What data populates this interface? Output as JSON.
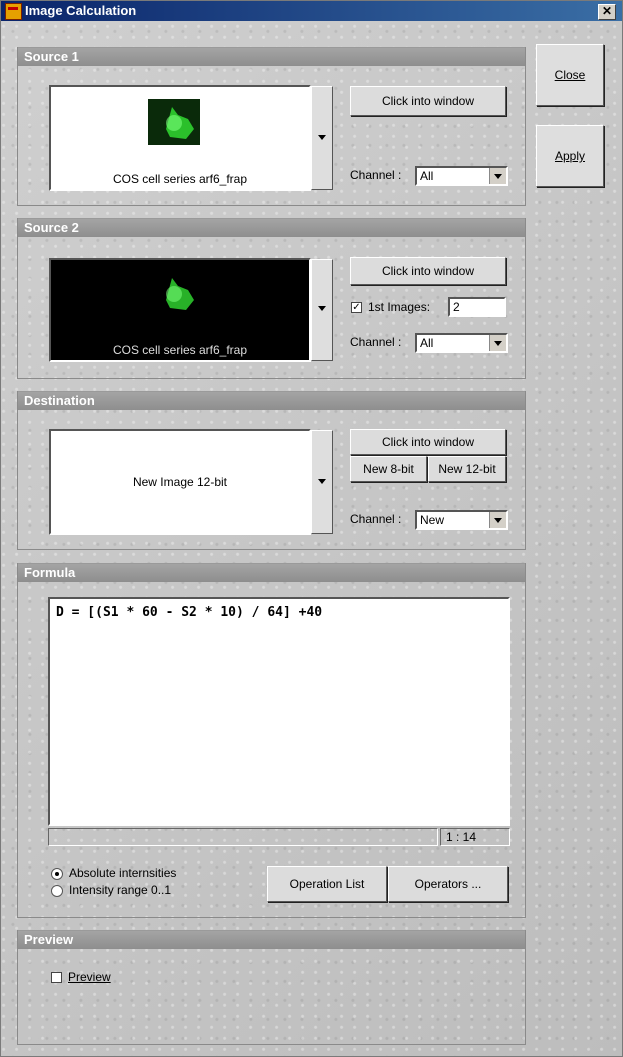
{
  "window": {
    "title": "Image Calculation",
    "close_glyph": "✕"
  },
  "side": {
    "close": "Close",
    "apply": "Apply"
  },
  "source1": {
    "header": "Source 1",
    "image_caption": "COS cell series arf6_frap",
    "click_btn": "Click into window",
    "channel_label": "Channel :",
    "channel_value": "All"
  },
  "source2": {
    "header": "Source 2",
    "image_caption": "COS cell series arf6_frap",
    "click_btn": "Click into window",
    "first_images_label": "1st Images:",
    "first_images_checked": true,
    "first_images_value": "2",
    "channel_label": "Channel :",
    "channel_value": "All"
  },
  "destination": {
    "header": "Destination",
    "image_caption": "New Image 12-bit",
    "click_btn": "Click into window",
    "new8": "New 8-bit",
    "new12": "New 12-bit",
    "channel_label": "Channel :",
    "channel_value": "New"
  },
  "formula": {
    "header": "Formula",
    "text": "D = [(S1 * 60 - S2 * 10) / 64] +40",
    "status_left": "",
    "cursor_pos": "1 : 14",
    "options": [
      {
        "label": "Absolute internsities",
        "selected": true
      },
      {
        "label": "Intensity range 0..1",
        "selected": false
      }
    ],
    "operation_list": "Operation List",
    "operators": "Operators ..."
  },
  "preview": {
    "header": "Preview",
    "checkbox_label": "Preview",
    "checked": false
  },
  "colors": {
    "title_bar": "#0a246a",
    "group_header": "#8e8e8e",
    "cell_green": "#2fd02f"
  },
  "icons": [
    "app-icon",
    "close-icon",
    "dropdown-arrow-icon",
    "checkbox-icon",
    "radio-icon",
    "cell-thumbnail"
  ]
}
